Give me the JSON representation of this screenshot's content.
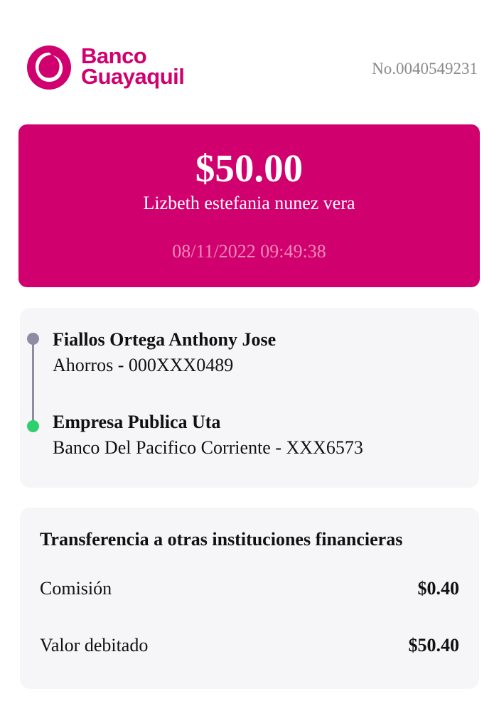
{
  "header": {
    "brand_line1": "Banco",
    "brand_line2": "Guayaquil",
    "brand_color": "#d1006f",
    "reference_number": "No.0040549231"
  },
  "summary": {
    "amount": "$50.00",
    "beneficiary": "Lizbeth estefania nunez vera",
    "datetime": "08/11/2022 09:49:38",
    "card_color": "#d1006f"
  },
  "accounts": {
    "from": {
      "name": "Fiallos Ortega Anthony Jose",
      "detail": "Ahorros - 000XXX0489",
      "dot_color": "#8d8ca3"
    },
    "to": {
      "name": "Empresa Publica Uta",
      "detail": "Banco Del Pacifico Corriente - XXX6573",
      "dot_color": "#2ed06e"
    }
  },
  "details": {
    "transfer_type": "Transferencia a otras instituciones financieras",
    "rows": [
      {
        "label": "Comisión",
        "value": "$0.40"
      },
      {
        "label": "Valor debitado",
        "value": "$50.40"
      }
    ]
  }
}
